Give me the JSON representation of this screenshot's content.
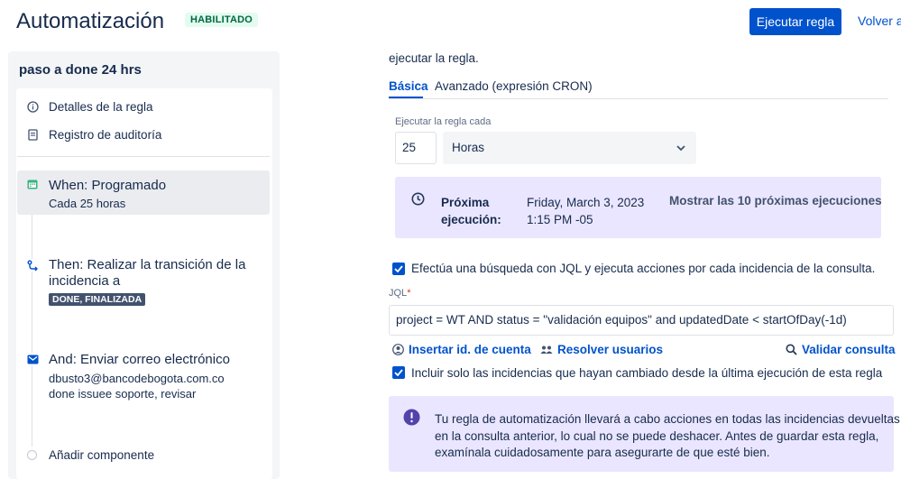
{
  "header": {
    "title": "Automatización",
    "status_badge": "HABILITADO",
    "run_button": "Ejecutar regla",
    "back_link": "Volver a"
  },
  "sidebar": {
    "rule_name": "paso a done 24 hrs",
    "menu": [
      {
        "label": "Detalles de la regla",
        "icon": "info-icon"
      },
      {
        "label": "Registro de auditoría",
        "icon": "clipboard-icon"
      }
    ],
    "steps": [
      {
        "title": "When: Programado",
        "subtitle": "Cada 25 horas",
        "icon": "calendar-icon"
      },
      {
        "title_line1": "Then: Realizar la transición de la",
        "title_line2": "incidencia a",
        "lozenge": "DONE, FINALIZADA",
        "icon": "transition-icon"
      },
      {
        "title": "And: Enviar correo electrónico",
        "line1": "dbusto3@bancodebogota.com.co",
        "line2": "done issuee soporte, revisar",
        "icon": "mail-icon"
      }
    ],
    "add_component": "Añadir componente"
  },
  "main": {
    "intro_text": "ejecutar la regla.",
    "tabs": [
      "Básica",
      "Avanzado (expresión CRON)"
    ],
    "interval_label": "Ejecutar la regla cada",
    "interval_value": "25",
    "interval_unit": "Horas",
    "next_run": {
      "label_line1": "Próxima",
      "label_line2": "ejecución:",
      "date": "Friday, March 3, 2023",
      "time": "1:15 PM -05",
      "show_more": "Mostrar las 10 próximas ejecuciones"
    },
    "jql_checkbox_label": "Efectúa una búsqueda con JQL y ejecuta acciones por cada incidencia de la consulta.",
    "jql_label": "JQL",
    "jql_required": "*",
    "jql_value": "project = WT AND status = \"validación equipos\" and updatedDate < startOfDay(-1d)",
    "actions": {
      "insert_account": "Insertar id. de cuenta",
      "resolve_users": "Resolver usuarios",
      "validate_query": "Validar consulta"
    },
    "changed_only_label": "Incluir solo las incidencias que hayan cambiado desde la última ejecución de esta regla",
    "warning": {
      "line1": "Tu regla de automatización llevará a cabo acciones en todas las incidencias devueltas",
      "line2": "en la consulta anterior, lo cual no se puede deshacer. Antes de guardar esta regla,",
      "line3": "examínala cuidadosamente para asegurarte de que esté bien."
    }
  },
  "colors": {
    "primary": "#0052cc",
    "panel": "#eae6ff",
    "badge_bg": "#e3fcef",
    "badge_text": "#006644",
    "info_icon": "#5243aa"
  }
}
